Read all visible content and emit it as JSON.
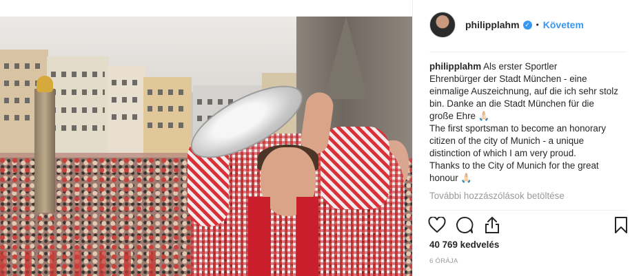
{
  "post": {
    "username": "philipplahm",
    "verified_mark": "✓",
    "separator": "•",
    "follow_label": "Követem",
    "caption_user": "philipplahm",
    "caption_text": "Als erster Sportler\nEhrenbürger der Stadt München - eine einmalige Auszeichnung, auf die ich sehr stolz bin. Danke an die Stadt München für die große Ehre 🙏🏻\nThe first sportsman to become an honorary citizen of the city of Munich - a unique distinction of which I am very proud.\nThanks to the City of Munich for the great honour 🙏🏻",
    "load_more": "További hozzászólások betöltése",
    "likes": "40 769 kedvelés",
    "time": "6 ÓRÁJA"
  },
  "colors": {
    "accent": "#3897f0",
    "text": "#262626",
    "muted": "#999999"
  },
  "icons": {
    "like": "heart-icon",
    "comment": "comment-icon",
    "share": "share-icon",
    "save": "bookmark-icon",
    "verified": "verified-badge-icon"
  }
}
